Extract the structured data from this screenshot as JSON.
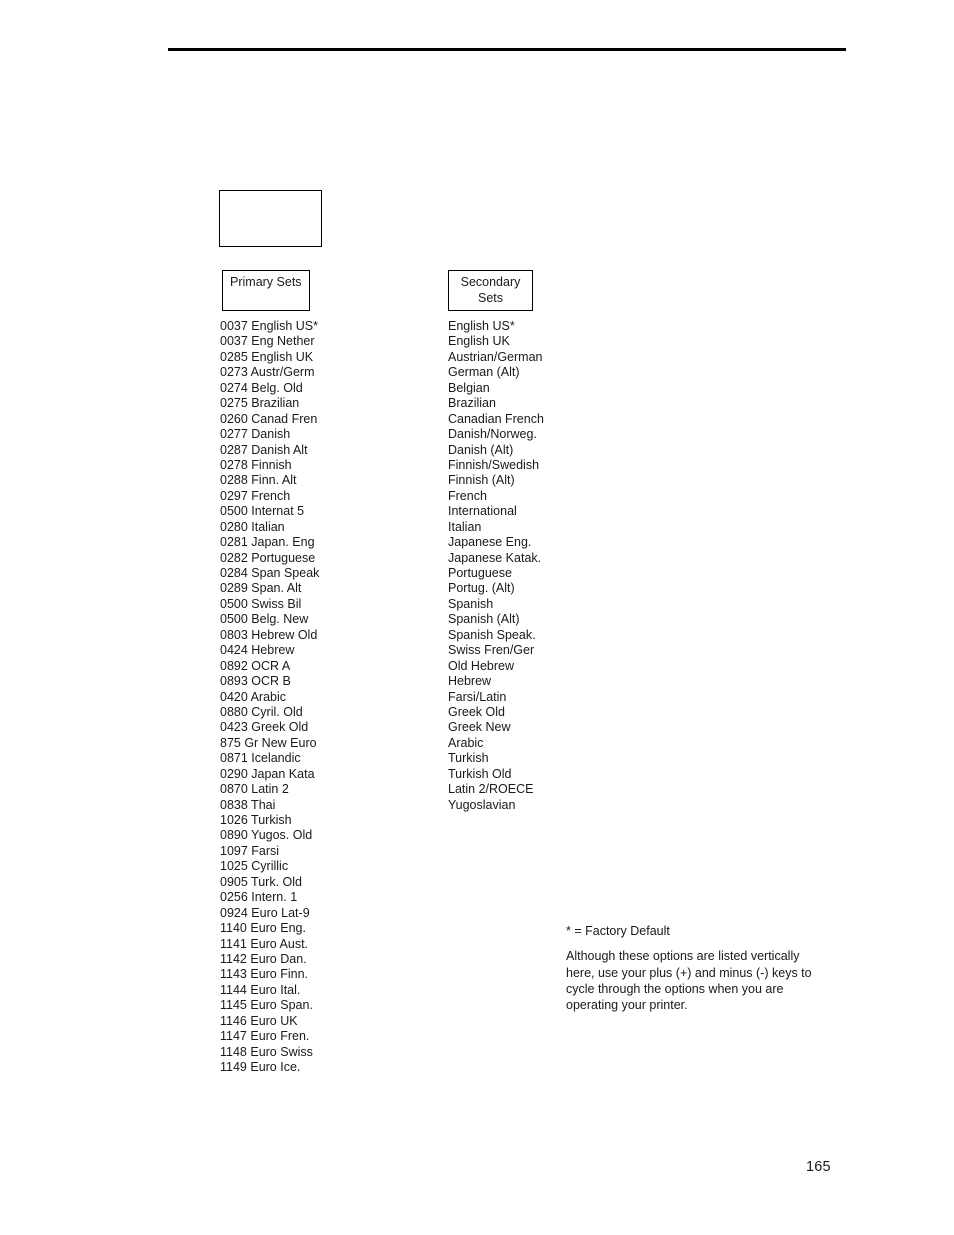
{
  "page": {
    "number": "165"
  },
  "diagram": {
    "empty_box_label": "",
    "primary_header": "Primary Sets",
    "secondary_header_line1": "Secondary",
    "secondary_header_line2": "Sets"
  },
  "primary_sets": [
    "0037 English US*",
    "0037 Eng Nether",
    "0285 English UK",
    "0273 Austr/Germ",
    "0274 Belg. Old",
    "0275 Brazilian",
    "0260 Canad Fren",
    "0277 Danish",
    "0287 Danish Alt",
    "0278 Finnish",
    "0288 Finn. Alt",
    "0297 French",
    "0500 Internat 5",
    "0280 Italian",
    "0281 Japan. Eng",
    "0282 Portuguese",
    "0284 Span Speak",
    "0289 Span. Alt",
    "0500 Swiss Bil",
    "0500 Belg. New",
    "0803 Hebrew Old",
    "0424 Hebrew",
    "0892 OCR A",
    "0893 OCR B",
    "0420 Arabic",
    "0880 Cyril. Old",
    "0423 Greek Old",
    "875 Gr New Euro",
    "0871 Icelandic",
    "0290 Japan Kata",
    "0870 Latin 2",
    "0838 Thai",
    "1026 Turkish",
    "0890 Yugos. Old",
    "1097 Farsi",
    "1025 Cyrillic",
    "0905 Turk. Old",
    "0256 Intern. 1",
    "0924 Euro Lat-9",
    "1140 Euro Eng.",
    "1141 Euro Aust.",
    "1142 Euro Dan.",
    "1143 Euro Finn.",
    "1144 Euro Ital.",
    "1145 Euro Span.",
    "1146 Euro UK",
    "1147 Euro Fren.",
    "1148 Euro Swiss",
    "1149 Euro Ice."
  ],
  "secondary_sets": [
    "English US*",
    "English UK",
    "Austrian/German",
    "German (Alt)",
    "Belgian",
    "Brazilian",
    "Canadian French",
    "Danish/Norweg.",
    "Danish (Alt)",
    "Finnish/Swedish",
    "Finnish (Alt)",
    "French",
    "International",
    "Italian",
    "Japanese Eng.",
    "Japanese Katak.",
    "Portuguese",
    "Portug. (Alt)",
    "Spanish",
    "Spanish (Alt)",
    "Spanish Speak.",
    "Swiss Fren/Ger",
    "Old Hebrew",
    "Hebrew",
    "Farsi/Latin",
    "Greek Old",
    "Greek New",
    "Arabic",
    "Turkish",
    "Turkish Old",
    "Latin 2/ROECE",
    "Yugoslavian"
  ],
  "footnote": {
    "factory_default": "* = Factory Default",
    "body": "Although these options are listed vertically here, use your plus (+) and minus (-) keys to cycle through the options when you are operating your printer."
  }
}
